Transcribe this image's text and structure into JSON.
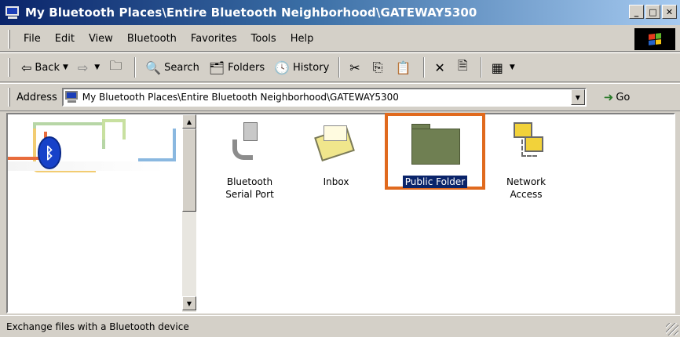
{
  "window": {
    "title": "My Bluetooth Places\\Entire Bluetooth Neighborhood\\GATEWAY5300",
    "minimize": "_",
    "maximize": "□",
    "close": "✕"
  },
  "menu": {
    "items": [
      "File",
      "Edit",
      "View",
      "Bluetooth",
      "Favorites",
      "Tools",
      "Help"
    ]
  },
  "toolbar": {
    "back_label": "Back",
    "search_label": "Search",
    "folders_label": "Folders",
    "history_label": "History"
  },
  "address": {
    "label": "Address",
    "value": "My Bluetooth Places\\Entire Bluetooth Neighborhood\\GATEWAY5300",
    "go_label": "Go"
  },
  "items": [
    {
      "label_line1": "Bluetooth",
      "label_line2": "Serial Port",
      "icon": "serial-port-icon"
    },
    {
      "label_line1": "Inbox",
      "label_line2": "",
      "icon": "inbox-icon"
    },
    {
      "label_line1": "Public Folder",
      "label_line2": "",
      "icon": "folder-icon",
      "selected": true
    },
    {
      "label_line1": "Network",
      "label_line2": "Access",
      "icon": "network-access-icon"
    }
  ],
  "status": {
    "text": "Exchange files with a Bluetooth device"
  },
  "colors": {
    "title_gradient_start": "#0a246a",
    "selection_frame": "#e06a1e",
    "selected_label_bg": "#0a246a",
    "bluetooth_blue": "#1742c9"
  }
}
